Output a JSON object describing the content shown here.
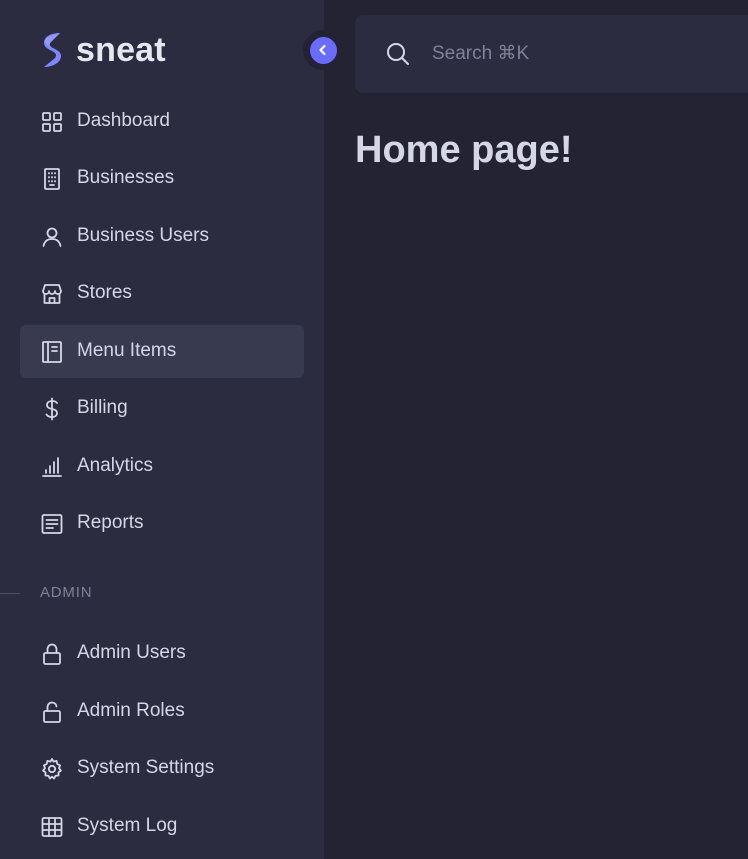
{
  "brand": {
    "name": "sneat",
    "logo_icon": "sneat-logo-icon",
    "accent_color": "#696cff"
  },
  "sidebar": {
    "collapse_icon": "chevron-left-icon",
    "items": [
      {
        "label": "Dashboard",
        "icon": "dashboard-grid-icon",
        "active": false
      },
      {
        "label": "Businesses",
        "icon": "building-icon",
        "active": false
      },
      {
        "label": "Business Users",
        "icon": "user-icon",
        "active": false
      },
      {
        "label": "Stores",
        "icon": "store-icon",
        "active": false
      },
      {
        "label": "Menu Items",
        "icon": "notebook-icon",
        "active": true
      },
      {
        "label": "Billing",
        "icon": "dollar-icon",
        "active": false
      },
      {
        "label": "Analytics",
        "icon": "bar-chart-icon",
        "active": false
      },
      {
        "label": "Reports",
        "icon": "report-icon",
        "active": false
      }
    ],
    "admin_section": {
      "header": "ADMIN",
      "items": [
        {
          "label": "Admin Users",
          "icon": "lock-icon",
          "active": false
        },
        {
          "label": "Admin Roles",
          "icon": "lock-open-icon",
          "active": false
        },
        {
          "label": "System Settings",
          "icon": "gear-icon",
          "active": false
        },
        {
          "label": "System Log",
          "icon": "table-icon",
          "active": false
        }
      ]
    }
  },
  "search": {
    "placeholder": "Search ⌘K",
    "value": ""
  },
  "main": {
    "title": "Home page!"
  },
  "colors": {
    "sidebar_bg": "#2b2c40",
    "content_bg": "#232333",
    "active_item_bg": "#383a4f",
    "text": "#d5d6e6",
    "muted_text": "#7f8199"
  }
}
